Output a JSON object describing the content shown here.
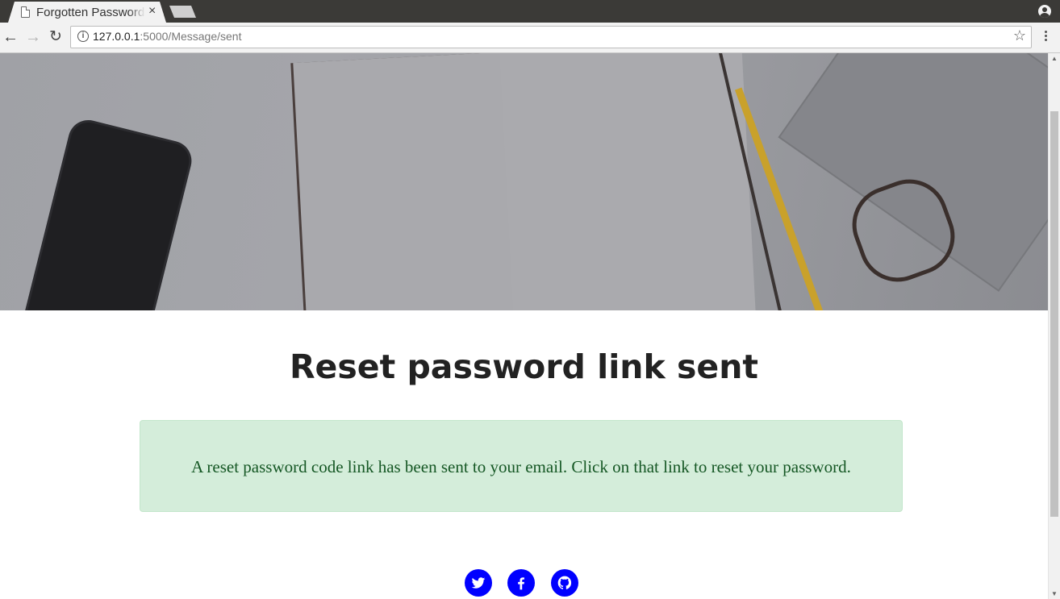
{
  "browser": {
    "tab_title": "Forgotten Password",
    "tab_close": "×",
    "url_host": "127.0.0.1",
    "url_rest": ":5000/Message/sent",
    "info_glyph": "i",
    "star_glyph": "☆",
    "back_glyph": "←",
    "forward_glyph": "→",
    "reload_glyph": "↻"
  },
  "page": {
    "title": "Reset password link sent",
    "alert_message": "A reset password code link has been sent to your email. Click on that link to reset your password."
  },
  "social": {
    "icons": [
      "twitter-icon",
      "facebook-icon",
      "github-icon"
    ],
    "color": "#0000ff"
  },
  "colors": {
    "alert_bg": "#d4edda",
    "alert_border": "#c3e6cb",
    "alert_text": "#155724",
    "title_text": "#222222"
  }
}
